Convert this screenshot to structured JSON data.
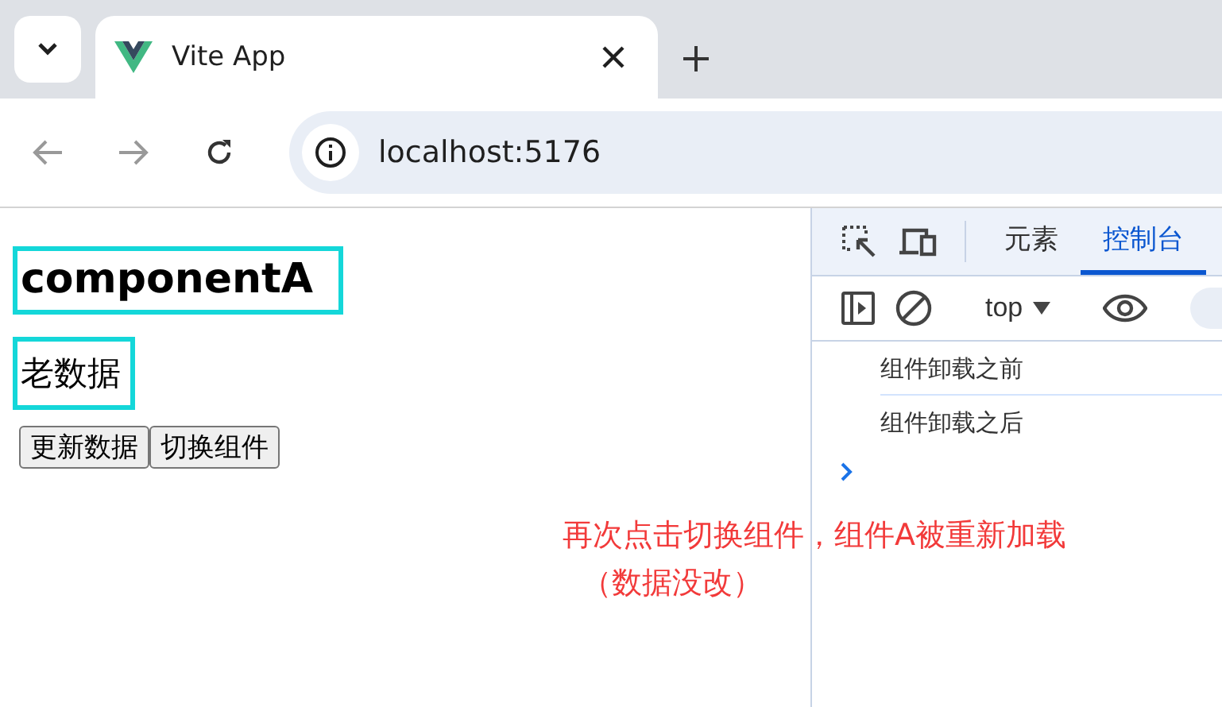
{
  "browser": {
    "tab_title": "Vite App",
    "url": "localhost:5176"
  },
  "page": {
    "heading": "componentA",
    "data_text": "老数据",
    "buttons": [
      "更新数据",
      "切换组件"
    ]
  },
  "devtools": {
    "tabs": [
      {
        "label": "元素",
        "selected": false
      },
      {
        "label": "控制台",
        "selected": true
      }
    ],
    "context": "top",
    "logs": [
      "组件卸载之前",
      "组件卸载之后"
    ]
  },
  "annotation": [
    "再次点击切换组件，组件A被重新加载",
    "（数据没改）"
  ]
}
